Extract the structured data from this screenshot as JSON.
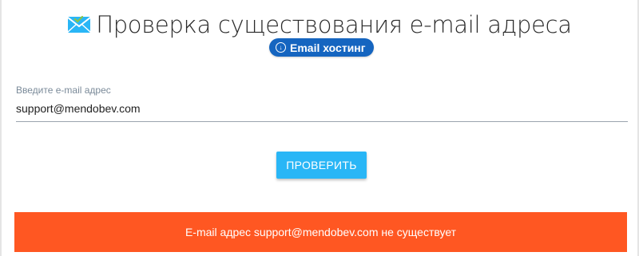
{
  "header": {
    "title": "Проверка существования e-mail адреса",
    "icon": "envelope-check-icon",
    "badge_label": "Email хостинг",
    "badge_icon": "download-circle-icon",
    "badge_color": "#1565c0"
  },
  "form": {
    "label": "Введите e-mail адрес",
    "email_value": "support@mendobev.com"
  },
  "button": {
    "label": "ПРОВЕРИТЬ",
    "color": "#29b6f6"
  },
  "result": {
    "message": "E-mail адрес support@mendobev.com не существует",
    "color": "#ff5722"
  }
}
